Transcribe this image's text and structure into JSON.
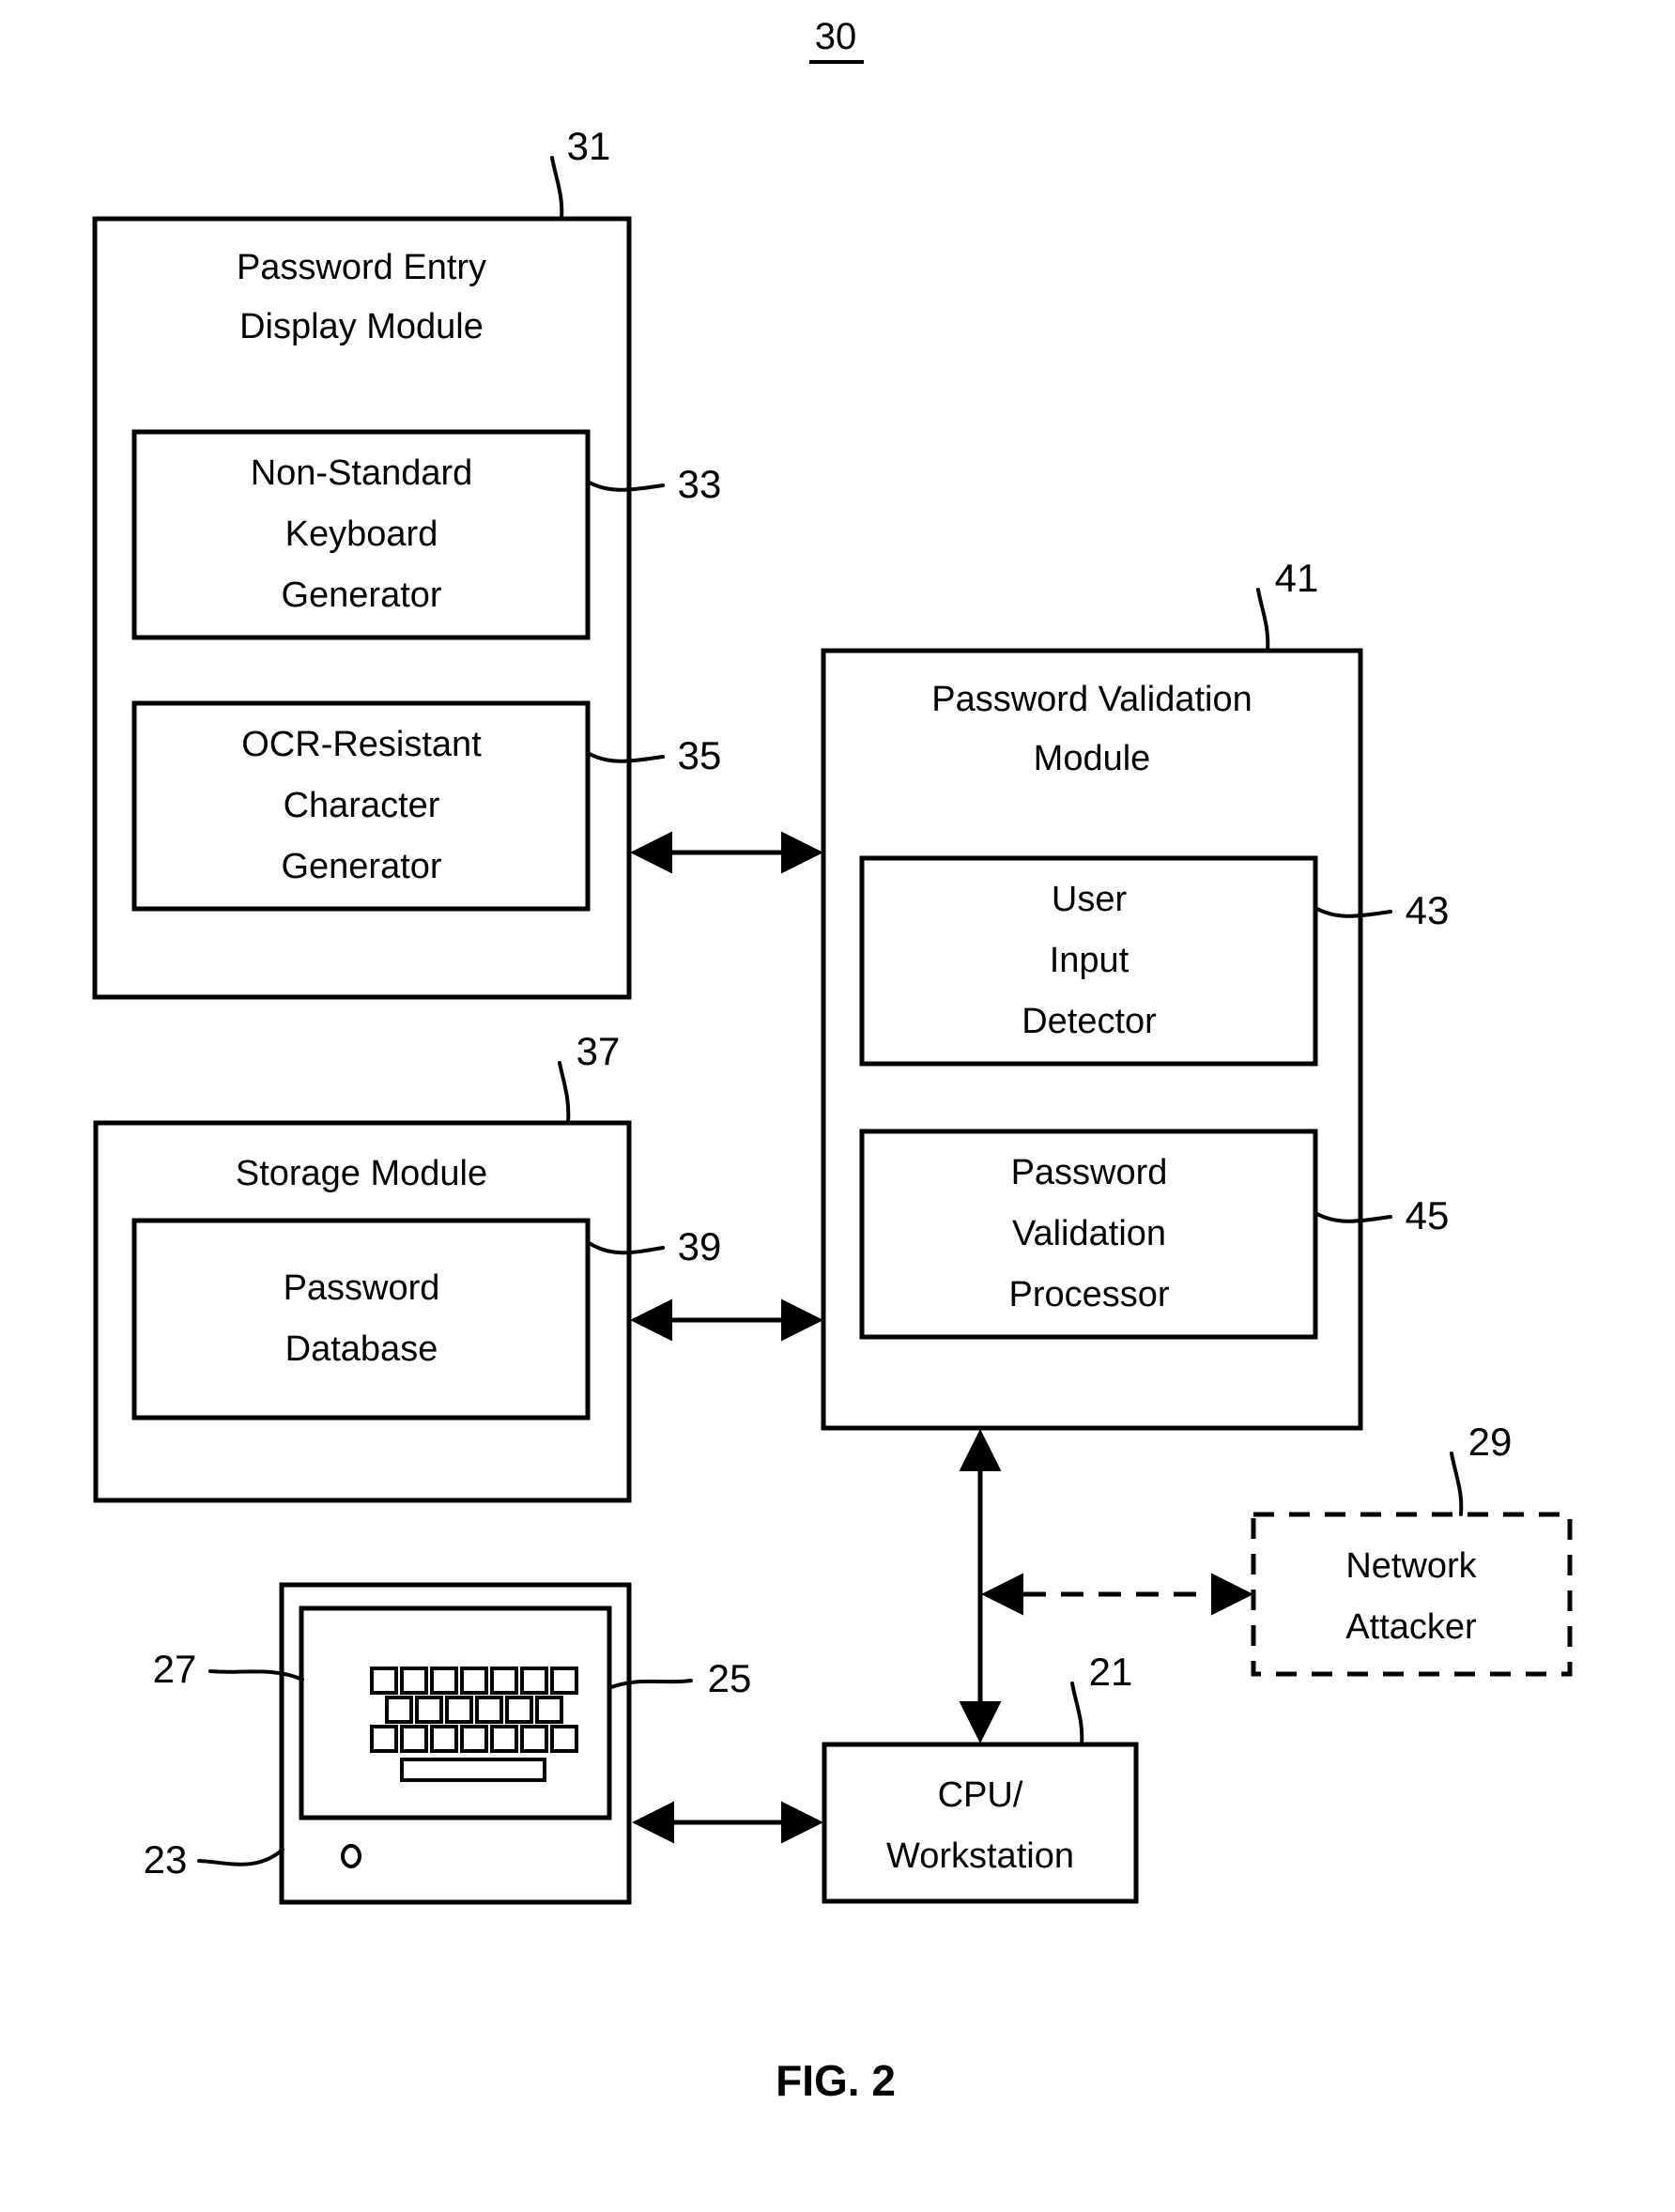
{
  "figure": {
    "system_ref": "30",
    "caption": "FIG. 2"
  },
  "blocks": {
    "password_entry_display_module": {
      "label_line1": "Password Entry",
      "label_line2": "Display Module",
      "ref": "31",
      "children": {
        "non_standard_keyboard_generator": {
          "label_line1": "Non-Standard",
          "label_line2": "Keyboard",
          "label_line3": "Generator",
          "ref": "33"
        },
        "ocr_resistant_character_generator": {
          "label_line1": "OCR-Resistant",
          "label_line2": "Character",
          "label_line3": "Generator",
          "ref": "35"
        }
      }
    },
    "storage_module": {
      "label_line1": "Storage Module",
      "ref": "37",
      "children": {
        "password_database": {
          "label_line1": "Password",
          "label_line2": "Database",
          "ref": "39"
        }
      }
    },
    "password_validation_module": {
      "label_line1": "Password Validation",
      "label_line2": "Module",
      "ref": "41",
      "children": {
        "user_input_detector": {
          "label_line1": "User",
          "label_line2": "Input",
          "label_line3": "Detector",
          "ref": "43"
        },
        "password_validation_processor": {
          "label_line1": "Password",
          "label_line2": "Validation",
          "label_line3": "Processor",
          "ref": "45"
        }
      }
    },
    "network_attacker": {
      "label_line1": "Network",
      "label_line2": "Attacker",
      "ref": "29",
      "style": "dashed"
    },
    "cpu_workstation": {
      "label_line1": "CPU/",
      "label_line2": "Workstation",
      "ref": "21"
    },
    "monitor": {
      "ref": "23",
      "screen_ref": "25",
      "keyboard_ref": "27",
      "keyboard": {
        "row1_keys": 7,
        "row2_keys": 6,
        "row3_keys": 7,
        "spacebar": 1
      }
    }
  },
  "connectors": [
    {
      "name": "display-module-to-validation-module",
      "style": "solid",
      "arrows": "both"
    },
    {
      "name": "storage-module-to-validation-module",
      "style": "solid",
      "arrows": "both"
    },
    {
      "name": "validation-module-to-cpu",
      "style": "solid",
      "arrows": "both"
    },
    {
      "name": "cpu-to-network-attacker",
      "style": "dashed",
      "arrows": "both"
    },
    {
      "name": "monitor-to-cpu",
      "style": "solid",
      "arrows": "both"
    }
  ],
  "colors": {
    "stroke": "#000000",
    "background": "#ffffff"
  }
}
